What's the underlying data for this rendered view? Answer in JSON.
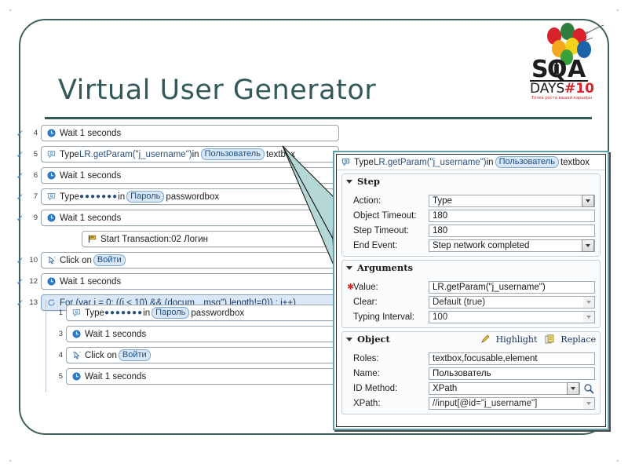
{
  "slide": {
    "title": "Virtual User Generator",
    "logo": {
      "name": "sqa-days-logo",
      "line1": "SQA",
      "line2": "DAYS#10",
      "tagline": "Точка роста вашей карьеры"
    }
  },
  "step_list": {
    "rows": [
      {
        "num": "4",
        "check": "✓",
        "icon": "clock-icon",
        "kind": "wait",
        "indent": 0,
        "highlight": false,
        "text": "Wait 1 seconds"
      },
      {
        "num": "5",
        "check": "✓",
        "icon": "type-icon",
        "kind": "type",
        "indent": 0,
        "highlight": false,
        "prefix": "Type ",
        "code": "LR.getParam(\"j_username\")",
        "mid": " in ",
        "chip": "Пользователь",
        "suffix": " textbox"
      },
      {
        "num": "6",
        "check": "✓",
        "icon": "clock-icon",
        "kind": "wait",
        "indent": 0,
        "highlight": false,
        "text": "Wait 1 seconds"
      },
      {
        "num": "7",
        "check": "✓",
        "icon": "type-icon",
        "kind": "type",
        "indent": 0,
        "highlight": false,
        "prefix": "Type ",
        "dots": "●●●●●●●",
        "mid": " in ",
        "chip": "Пароль",
        "suffix": " passwordbox"
      },
      {
        "num": "9",
        "check": "✓",
        "icon": "clock-icon",
        "kind": "wait",
        "indent": 0,
        "highlight": false,
        "text": "Wait 1 seconds"
      },
      {
        "num": "",
        "check": "",
        "icon": "transaction-icon",
        "kind": "trans",
        "indent": 1,
        "highlight": false,
        "text": "Start Transaction:02 Логин"
      },
      {
        "num": "10",
        "check": "✓",
        "icon": "click-icon",
        "kind": "click",
        "indent": 0,
        "highlight": false,
        "prefix": "Click on ",
        "chip": "Войти",
        "suffix": ""
      },
      {
        "num": "12",
        "check": "✓",
        "icon": "clock-icon",
        "kind": "wait",
        "indent": 0,
        "highlight": false,
        "text": "Wait 1 seconds"
      },
      {
        "num": "13",
        "check": "✓",
        "icon": "loop-icon",
        "kind": "loop",
        "indent": 0,
        "highlight": true,
        "text": "For (var i = 0; ((i < 10) && (docum…msg\").length!=0)) ; i++)"
      }
    ],
    "nested_rows": [
      {
        "num": "1",
        "icon": "type-icon",
        "kind": "type",
        "prefix": "Type ",
        "dots": "●●●●●●●",
        "mid": " in ",
        "chip": "Пароль",
        "suffix": " passwordbox"
      },
      {
        "num": "3",
        "icon": "clock-icon",
        "kind": "wait",
        "text": "Wait 1 seconds"
      },
      {
        "num": "4",
        "icon": "click-icon",
        "kind": "click",
        "prefix": "Click on ",
        "chip": "Войти",
        "suffix": ""
      },
      {
        "num": "5",
        "icon": "clock-icon",
        "kind": "wait",
        "text": "Wait 1 seconds"
      }
    ]
  },
  "properties_panel": {
    "header": {
      "icon": "type-icon",
      "prefix": "Type ",
      "code": "LR.getParam(\"j_username\")",
      "mid": " in ",
      "chip": "Пользователь",
      "suffix": " textbox"
    },
    "step_section": {
      "title": "Step",
      "fields": [
        {
          "label": "Action:",
          "value": "Type",
          "control": "select"
        },
        {
          "label": "Object Timeout:",
          "value": "180",
          "control": "text"
        },
        {
          "label": "Step Timeout:",
          "value": "180",
          "control": "text"
        },
        {
          "label": "End Event:",
          "value": "Step network completed",
          "control": "select"
        }
      ]
    },
    "arguments_section": {
      "title": "Arguments",
      "fields": [
        {
          "label": "Value:",
          "value": "LR.getParam(\"j_username\")",
          "control": "text",
          "required": true
        },
        {
          "label": "Clear:",
          "value": "Default (true)",
          "control": "select",
          "required": false,
          "dim": true
        },
        {
          "label": "Typing Interval:",
          "value": "100",
          "control": "select",
          "required": false,
          "dim": true
        }
      ]
    },
    "object_section": {
      "title": "Object",
      "actions": [
        {
          "name": "highlight-action",
          "label": "Highlight",
          "icon": "pencil-icon"
        },
        {
          "name": "replace-action",
          "label": "Replace",
          "icon": "replace-icon"
        }
      ],
      "fields": [
        {
          "label": "Roles:",
          "value": "textbox,focusable,element",
          "control": "text"
        },
        {
          "label": "Name:",
          "value": "Пользователь",
          "control": "text"
        },
        {
          "label": "ID Method:",
          "value": "XPath",
          "control": "select-magnifier"
        },
        {
          "label": "XPath:",
          "value": "//input[@id=\"j_username\"]",
          "control": "select",
          "dim": true
        }
      ]
    }
  },
  "colors": {
    "frame": "#3f5f5d",
    "title": "#34595a",
    "rule": "#2f5b59",
    "callout": "#b9dcda",
    "panel_border": "#5fa0a6",
    "chip_bg": "#d8e7f6",
    "highlight_bg": "#dbe7f4",
    "check": "#4a8fd4"
  }
}
